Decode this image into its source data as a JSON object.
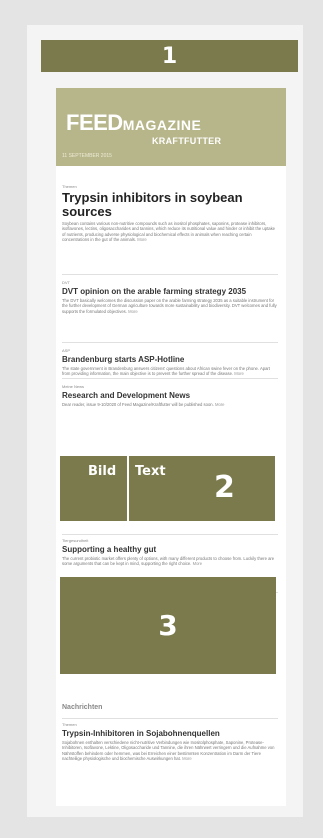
{
  "markers": {
    "one": "1",
    "two": "2",
    "three": "3"
  },
  "masthead": {
    "feed": "FEED",
    "magazine": "MAGAZINE",
    "kraftfutter": "KRAFTFUTTER",
    "date": "11 SEPTEMBER 2015"
  },
  "articles": [
    {
      "rubric": "Themen",
      "title": "Trypsin inhibitors  in soybean sources",
      "body": "Soybean contains various non-nutritive compounds such as inositol phosphates, saponins, protease inhibitors, isoflavones, lectins, oligosaccharides and tannins, which reduce its nutritional value and hinder or inhibit the uptake of nutrients, producing adverse physiological and biochemical effects in animals when reaching certain concentrations in the gut of the animals.",
      "more": "More"
    },
    {
      "rubric": "DVT",
      "title": "DVT opinion on the arable farming strategy 2035",
      "body": "The DVT basically welcomes the discussion paper on the arable farming strategy 2035 as a suitable instrument for the further development of German agriculture towards more sustainability and biodiversity. DVT welcomes and fully supports the formulated objectives.",
      "more": "More"
    },
    {
      "rubric": "ASP",
      "title": "Brandenburg starts ASP-Hotline",
      "body": "The state government in Brandenburg answers citizens' questions about African swine fever on the phone. Apart from providing information, the main objective is to prevent the further spread of the disease.",
      "more": "More"
    },
    {
      "rubric": "Meine News",
      "title": "Research and Development News",
      "body": "Dear reader, issue 9-10/2020 of Feed Magazine/Kraftfutter will be published soon.",
      "more": "More"
    },
    {
      "rubric": "Tiergesundheit",
      "title": "Supporting a healthy gut",
      "body": "The current probiotic market offers plenty of options, with many different products to choose from. Luckily there are some arguments that can be kept in mind, supporting the right choice.",
      "more": "More"
    },
    {
      "rubric": "Anzeige",
      "title": "",
      "body": "",
      "more": ""
    },
    {
      "rubric": "Themen",
      "title": "Trypsin-Inhibitoren in Sojabohnenquellen",
      "body": "Sojabohnen enthalten verschiedene nicht-nutritive Verbindungen wie Inositolphosphate, Saponine, Protease-Inhibitoren, Isoflavone, Lektine, Oligosaccharide und Tannine, die ihren Nährwert verringern und die Aufnahme von Nährstoffen behindern oder hemmen, was bei Erreichen einer bestimmten Konzentration im Darm der Tiere nachteilige physiologische und biochemische Auswirkungen hat.",
      "more": "More"
    }
  ],
  "module2": {
    "bild": "Bild",
    "text": "Text"
  },
  "section": {
    "nachrichten": "Nachrichten"
  }
}
